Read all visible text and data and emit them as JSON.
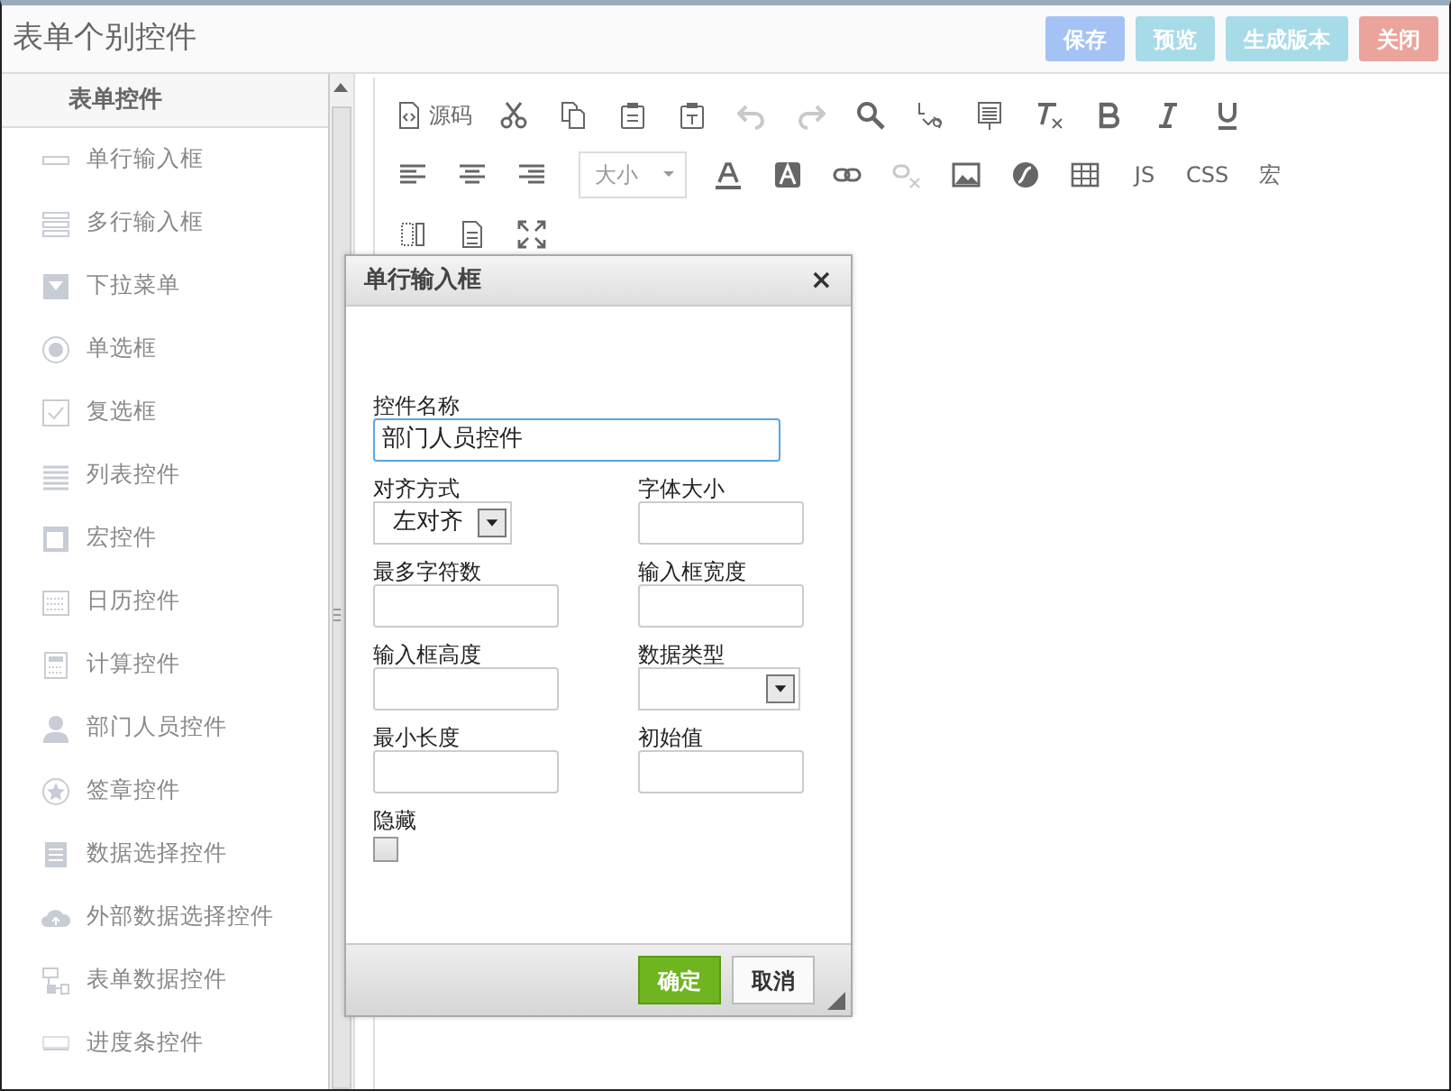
{
  "header": {
    "title": "表单个别控件",
    "buttons": [
      {
        "label": "保存",
        "color": "#a4c2f4"
      },
      {
        "label": "预览",
        "color": "#a8dbe8"
      },
      {
        "label": "生成版本",
        "color": "#a8dbe8"
      },
      {
        "label": "关闭",
        "color": "#eaa49c"
      }
    ]
  },
  "sidebar": {
    "title": "表单控件",
    "items": [
      {
        "label": "单行输入框"
      },
      {
        "label": "多行输入框"
      },
      {
        "label": "下拉菜单"
      },
      {
        "label": "单选框"
      },
      {
        "label": "复选框"
      },
      {
        "label": "列表控件"
      },
      {
        "label": "宏控件"
      },
      {
        "label": "日历控件"
      },
      {
        "label": "计算控件"
      },
      {
        "label": "部门人员控件"
      },
      {
        "label": "签章控件"
      },
      {
        "label": "数据选择控件"
      },
      {
        "label": "外部数据选择控件"
      },
      {
        "label": "表单数据控件"
      },
      {
        "label": "进度条控件"
      }
    ]
  },
  "toolbar": {
    "rows": [
      [
        {
          "kind": "icon-text",
          "label": "源码",
          "disabled": false
        },
        {
          "kind": "icon",
          "disabled": false
        },
        {
          "kind": "icon",
          "disabled": false
        },
        {
          "kind": "icon",
          "disabled": false
        },
        {
          "kind": "icon",
          "disabled": false
        },
        {
          "kind": "icon",
          "disabled": true
        },
        {
          "kind": "icon",
          "disabled": true
        },
        {
          "kind": "icon",
          "disabled": false
        },
        {
          "kind": "icon",
          "disabled": false
        },
        {
          "kind": "icon",
          "disabled": false
        },
        {
          "kind": "icon",
          "disabled": false
        },
        {
          "kind": "icon",
          "disabled": false
        },
        {
          "kind": "icon",
          "disabled": false
        },
        {
          "kind": "icon",
          "disabled": false
        }
      ],
      [
        {
          "kind": "icon",
          "disabled": false
        },
        {
          "kind": "icon",
          "disabled": false
        },
        {
          "kind": "icon",
          "disabled": false
        },
        {
          "kind": "select",
          "label": "大小",
          "disabled": false
        },
        {
          "kind": "icon",
          "disabled": false
        },
        {
          "kind": "icon",
          "disabled": false
        },
        {
          "kind": "icon",
          "disabled": false
        },
        {
          "kind": "icon",
          "disabled": true
        },
        {
          "kind": "icon",
          "disabled": false
        },
        {
          "kind": "icon",
          "disabled": false
        },
        {
          "kind": "icon",
          "disabled": false
        },
        {
          "kind": "text",
          "label": "JS",
          "disabled": false
        },
        {
          "kind": "text",
          "label": "CSS",
          "disabled": false
        },
        {
          "kind": "text",
          "label": "宏",
          "disabled": false
        }
      ],
      [
        {
          "kind": "icon",
          "disabled": false
        },
        {
          "kind": "icon",
          "disabled": false
        },
        {
          "kind": "icon",
          "disabled": false
        }
      ]
    ]
  },
  "dialog": {
    "title": "单行输入框",
    "close": "×",
    "fields": [
      {
        "kind": "text",
        "label": "控件名称",
        "value": "部门人员控件",
        "focused": true,
        "wide": true
      },
      {
        "kind": "select",
        "label": "对齐方式",
        "value": "左对齐"
      },
      {
        "kind": "text",
        "label": "字体大小"
      },
      {
        "kind": "text",
        "label": "最多字符数"
      },
      {
        "kind": "text",
        "label": "输入框宽度"
      },
      {
        "kind": "text",
        "label": "输入框高度"
      },
      {
        "kind": "select",
        "label": "数据类型"
      },
      {
        "kind": "text",
        "label": "最小长度"
      },
      {
        "kind": "text",
        "label": "初始值"
      },
      {
        "kind": "checkbox",
        "label": "隐藏",
        "checked": false
      }
    ],
    "buttons": [
      {
        "label": "确定",
        "primary": true
      },
      {
        "label": "取消",
        "primary": false
      }
    ]
  }
}
